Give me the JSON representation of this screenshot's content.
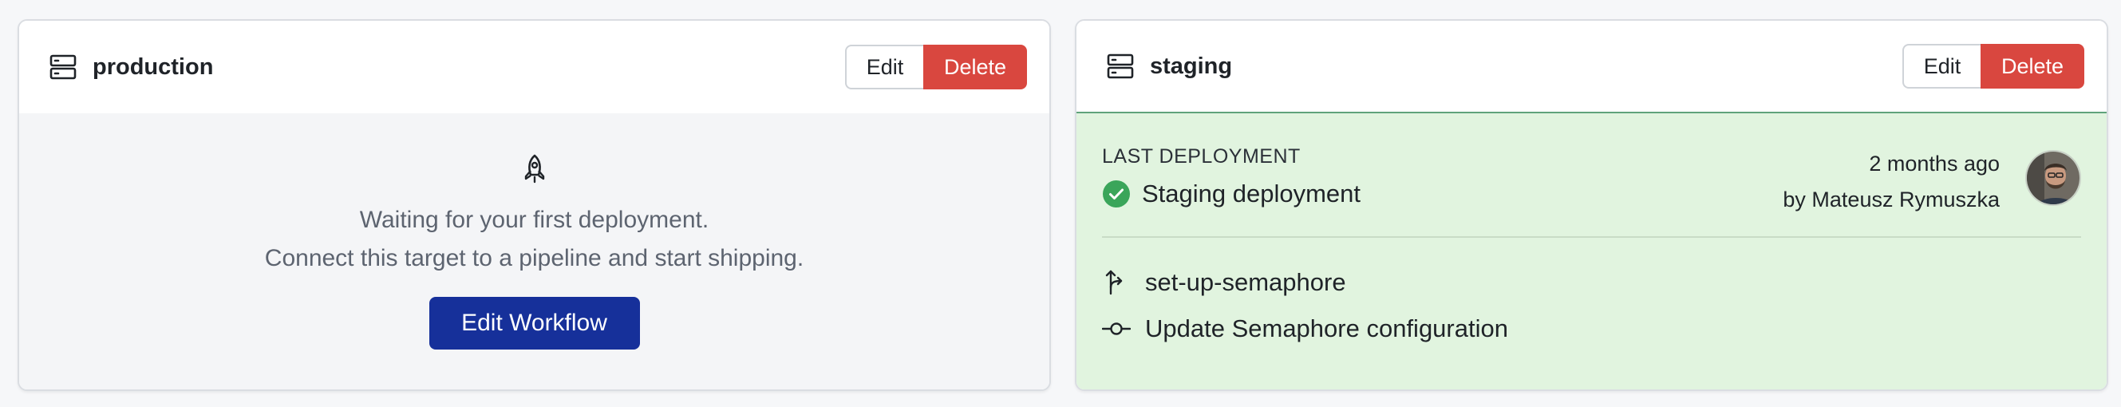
{
  "targets": [
    {
      "name": "production",
      "edit_label": "Edit",
      "delete_label": "Delete",
      "empty_state": {
        "line1": "Waiting for your first deployment.",
        "line2": "Connect this target to a pipeline and start shipping.",
        "button_label": "Edit Workflow",
        "icon": "rocket-icon"
      }
    },
    {
      "name": "staging",
      "edit_label": "Edit",
      "delete_label": "Delete",
      "last_deployment": {
        "label": "LAST DEPLOYMENT",
        "name": "Staging deployment",
        "status": "passed",
        "time_ago": "2 months ago",
        "by": "by Mateusz Rymuszka",
        "branch": "set-up-semaphore",
        "commit_message": "Update Semaphore configuration"
      }
    }
  ],
  "icons": {
    "target": "server-icon",
    "status": "check-circle-icon",
    "branch": "branch-icon",
    "commit": "commit-icon"
  },
  "colors": {
    "delete": "#d9473f",
    "primary": "#16309a",
    "success": "#3aa55a",
    "success_bg": "#e1f4df",
    "success_border": "#5fa37b"
  }
}
